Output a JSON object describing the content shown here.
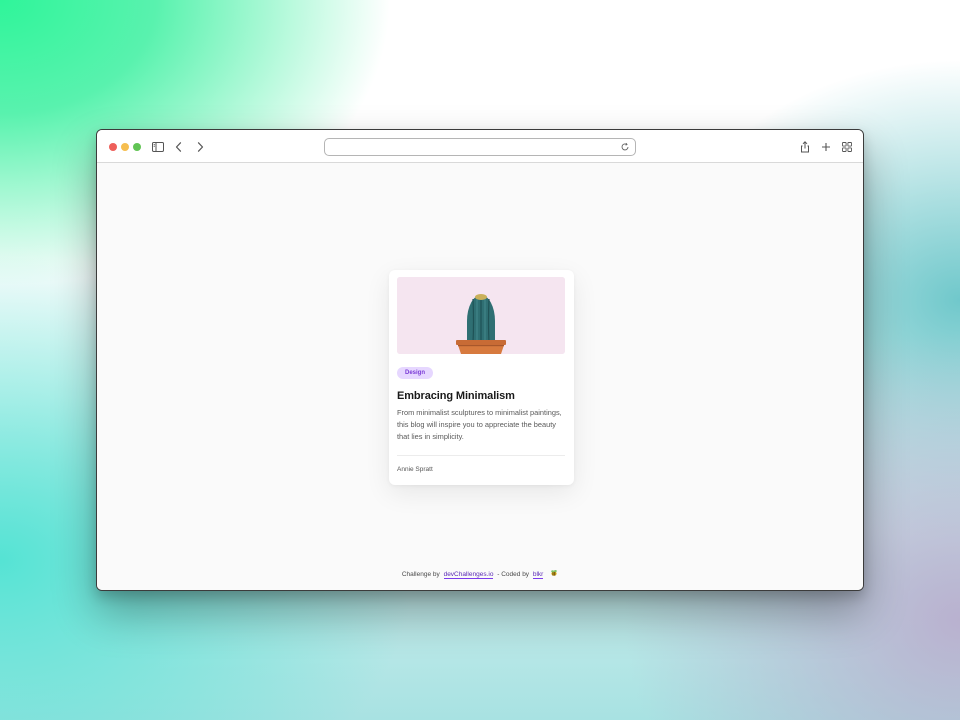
{
  "browser": {
    "url": "",
    "toolbar_icons": [
      "sidebar-icon",
      "back-icon",
      "forward-icon",
      "reload-icon",
      "share-icon",
      "new-tab-icon",
      "tab-overview-icon"
    ]
  },
  "card": {
    "image_subject": "cactus in terracotta pot",
    "tag": "Design",
    "title": "Embracing Minimalism",
    "description": "From minimalist sculptures to minimalist paintings, this blog will inspire you to appreciate the beauty that lies in simplicity.",
    "author": "Annie Spratt"
  },
  "footer": {
    "prefix": "Challenge by",
    "challenge_link": "devChallenges.io",
    "middle": "- Coded by",
    "coder_link": "blkr"
  },
  "colors": {
    "tag_bg": "#e6d7ff",
    "tag_text": "#7a3bd6",
    "image_bg": "#f5e5f0",
    "link": "#5b2bb5"
  }
}
